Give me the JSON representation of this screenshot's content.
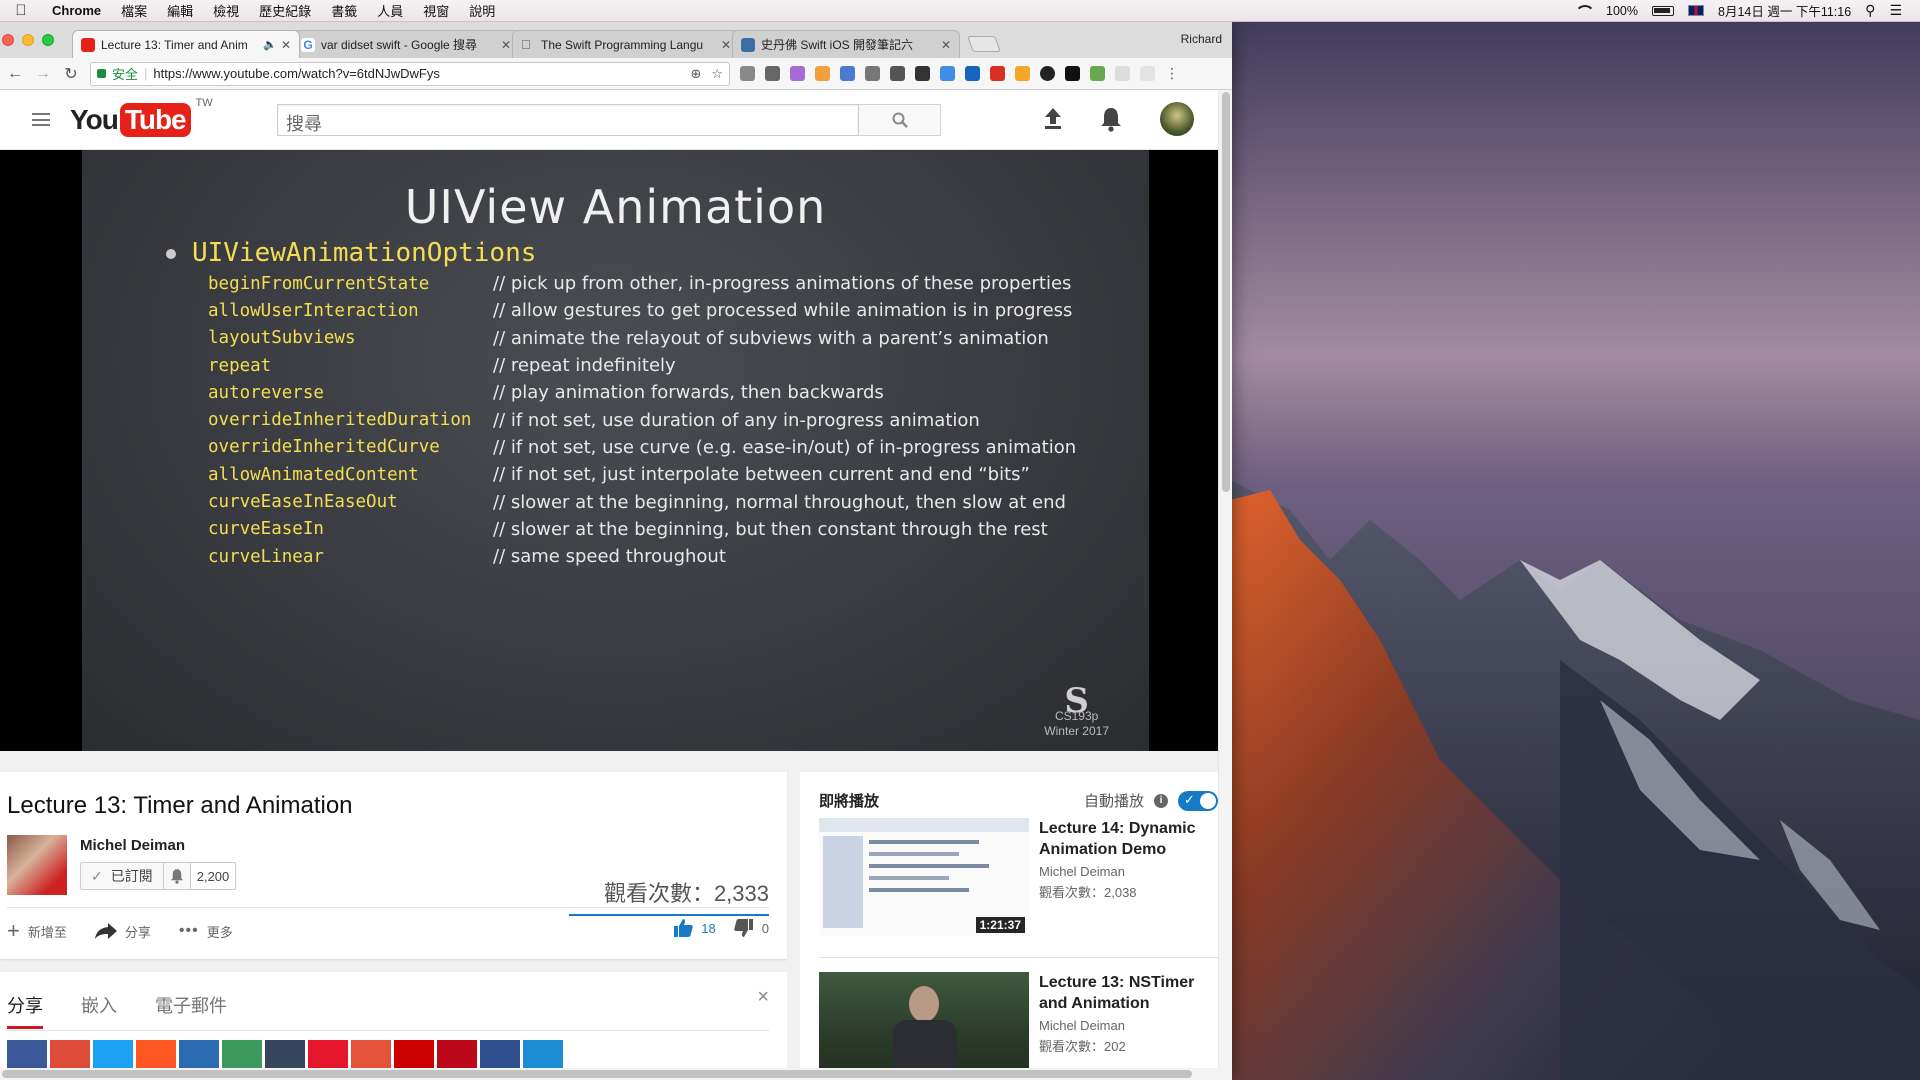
{
  "menubar": {
    "app": "Chrome",
    "items": [
      "檔案",
      "編輯",
      "檢視",
      "歷史紀錄",
      "書籤",
      "人員",
      "視窗",
      "說明"
    ],
    "battery": "100%",
    "datetime": "8月14日 週一 下午11:16",
    "user": "Richard"
  },
  "tabs": [
    {
      "title": "Lecture 13: Timer and Anim",
      "color": "#e62117"
    },
    {
      "title": "var didset swift - Google 搜尋",
      "color": "#4285f4"
    },
    {
      "title": "The Swift Programming Langu",
      "color": "#555555"
    },
    {
      "title": "史丹佛 Swift iOS 開發筆記六",
      "color": "#3a6ea5"
    }
  ],
  "toolbar": {
    "secure_label": "安全",
    "url": "https://www.youtube.com/watch?v=6tdNJwDwFys"
  },
  "youtube": {
    "logo_you": "You",
    "logo_tube": "Tube",
    "region": "TW",
    "search_placeholder": "搜尋"
  },
  "slide": {
    "title": "UIView Animation",
    "heading": "UIViewAnimationOptions",
    "options": [
      {
        "name": "beginFromCurrentState",
        "desc": "// pick up from other, in-progress animations of these properties"
      },
      {
        "name": "allowUserInteraction",
        "desc": "// allow gestures to get processed while animation is in progress"
      },
      {
        "name": "layoutSubviews",
        "desc": "// animate the relayout of subviews with a parent’s animation"
      },
      {
        "name": "repeat",
        "desc": "// repeat indefinitely"
      },
      {
        "name": "autoreverse",
        "desc": "// play animation forwards, then backwards"
      },
      {
        "name": "overrideInheritedDuration",
        "desc": "// if not set, use duration of any in-progress animation"
      },
      {
        "name": "overrideInheritedCurve",
        "desc": "// if not set, use curve (e.g. ease-in/out) of in-progress animation"
      },
      {
        "name": "allowAnimatedContent",
        "desc": "// if not set, just interpolate between current and end “bits”"
      },
      {
        "name": "curveEaseInEaseOut",
        "desc": "// slower at the beginning, normal throughout, then slow at end"
      },
      {
        "name": "curveEaseIn",
        "desc": "// slower at the beginning, but then constant through the rest"
      },
      {
        "name": "curveLinear",
        "desc": "// same speed throughout"
      }
    ],
    "course": "CS193p",
    "term": "Winter 2017"
  },
  "video": {
    "title": "Lecture 13: Timer and Animation",
    "channel": "Michel Deiman",
    "subscribed_label": "已訂閱",
    "subscribers": "2,200",
    "views": "觀看次數：2,333",
    "add_to": "新增至",
    "share": "分享",
    "more": "更多",
    "likes": "18",
    "dislikes": "0"
  },
  "share_panel": {
    "tabs": [
      "分享",
      "嵌入",
      "電子郵件"
    ],
    "close": "×",
    "social_colors": [
      "#3b5998",
      "#dd4b39",
      "#1da1f2",
      "#ff5722",
      "#2b6cb0",
      "#3c9a5f",
      "#35465c",
      "#e6162d",
      "#e3523b",
      "#cc0000",
      "#bd081c",
      "#2f4f8f",
      "#1c8cd6"
    ]
  },
  "sidebar": {
    "up_next": "即將播放",
    "autoplay": "自動播放",
    "info": "i",
    "recs": [
      {
        "title": "Lecture 14: Dynamic Animation Demo",
        "channel": "Michel Deiman",
        "views": "觀看次數：2,038",
        "duration": "1:21:37"
      },
      {
        "title": "Lecture 13: NSTimer and Animation",
        "channel": "Michel Deiman",
        "views": "觀看次數：202",
        "duration": ""
      }
    ]
  }
}
